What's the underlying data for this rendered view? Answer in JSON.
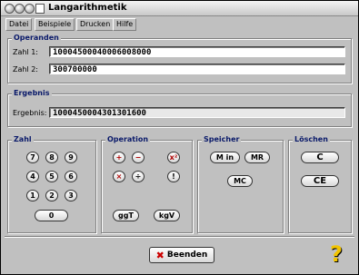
{
  "app": {
    "title": "Langarithmetik"
  },
  "menu": [
    "Datei",
    "Beispiele",
    "Drucken",
    "Hilfe"
  ],
  "operanden": {
    "legend": "Operanden",
    "zahl1_label": "Zahl 1:",
    "zahl1_value": "10004500040006008000",
    "zahl2_label": "Zahl 2:",
    "zahl2_value": "300700000"
  },
  "ergebnis": {
    "legend": "Ergebnis",
    "label": "Ergebnis:",
    "value": "1000450004301301600"
  },
  "zahl": {
    "legend": "Zahl",
    "digits": [
      "7",
      "8",
      "9",
      "4",
      "5",
      "6",
      "1",
      "2",
      "3",
      "0"
    ]
  },
  "operation": {
    "legend": "Operation",
    "plus": "+",
    "minus": "−",
    "square": "x²",
    "mult": "×",
    "div": "÷",
    "fact": "!",
    "ggt": "ggT",
    "kgv": "kgV"
  },
  "speicher": {
    "legend": "Speicher",
    "min": "M in",
    "mr": "MR",
    "mc": "MC"
  },
  "loeschen": {
    "legend": "Löschen",
    "c": "C",
    "ce": "CE"
  },
  "footer": {
    "beenden": "Beenden",
    "help_icon": "question-mark"
  },
  "colors": {
    "legend": "#0a1a6a",
    "window": "#c0c0c0",
    "beenden_x": "#cc0000"
  }
}
